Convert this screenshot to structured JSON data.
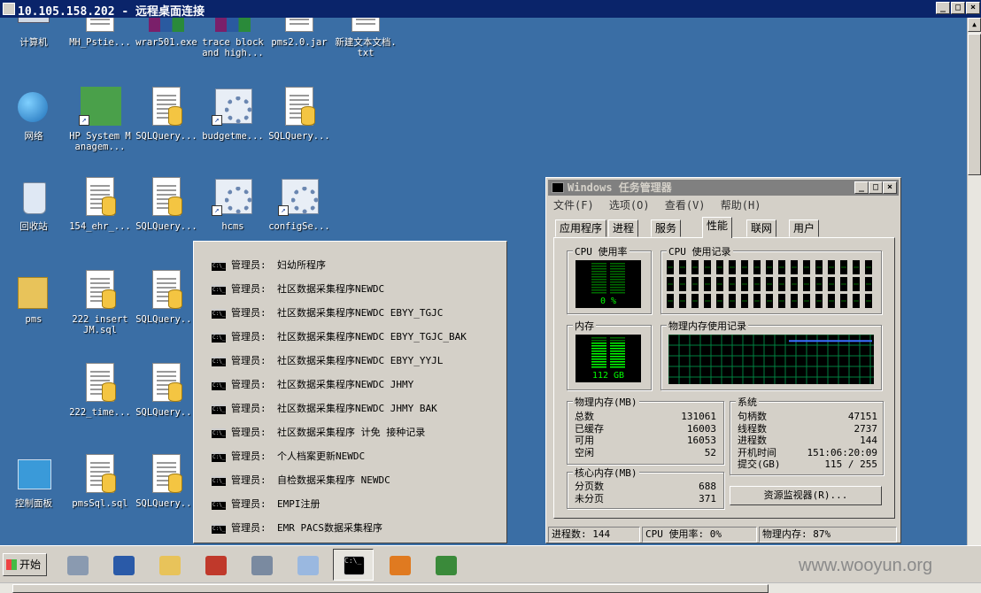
{
  "titlebar": {
    "title": "10.105.158.202 - 远程桌面连接",
    "controls": [
      "_",
      "□",
      "×"
    ]
  },
  "desktop_icons": [
    {
      "label": "计算机",
      "icon": "computer-icon"
    },
    {
      "label": "MH_Pstie...",
      "icon": "document-icon"
    },
    {
      "label": "wrar501.exe",
      "icon": "winrar-icon"
    },
    {
      "label": "trace block and high...",
      "icon": "winrar-archive-icon"
    },
    {
      "label": "pms2.0.jar",
      "icon": "java-jar-icon"
    },
    {
      "label": "新建文本文档.txt",
      "icon": "text-file-icon"
    },
    {
      "label": "网络",
      "icon": "network-icon"
    },
    {
      "label": "HP System Managem...",
      "icon": "hp-system-management-icon"
    },
    {
      "label": "SQLQuery...",
      "icon": "sql-file-icon"
    },
    {
      "label": "budgetme...",
      "icon": "config-shortcut-icon"
    },
    {
      "label": "SQLQuery...",
      "icon": "sql-file-icon"
    },
    {
      "label": "回收站",
      "icon": "recycle-bin-icon"
    },
    {
      "label": "154_ehr_...",
      "icon": "sql-file-icon"
    },
    {
      "label": "SQLQuery...",
      "icon": "sql-file-icon"
    },
    {
      "label": "hcms",
      "icon": "config-shortcut-icon"
    },
    {
      "label": "configSe...",
      "icon": "config-shortcut-icon"
    },
    {
      "label": "pms",
      "icon": "folder-icon"
    },
    {
      "label": "222 insert JM.sql",
      "icon": "sql-file-icon"
    },
    {
      "label": "SQLQuery...",
      "icon": "sql-file-icon"
    },
    {
      "label": "222_time...",
      "icon": "sql-file-icon"
    },
    {
      "label": "SQLQuery...",
      "icon": "sql-file-icon"
    },
    {
      "label": "控制面板",
      "icon": "control-panel-icon"
    },
    {
      "label": "pmsSql.sql",
      "icon": "sql-file-icon"
    },
    {
      "label": "SQLQuery...",
      "icon": "sql-file-icon"
    }
  ],
  "context_menu": {
    "admin_prefix": "管理员:",
    "items": [
      "妇幼所程序",
      "社区数据采集程序NEWDC",
      "社区数据采集程序NEWDC EBYY_TGJC",
      "社区数据采集程序NEWDC EBYY_TGJC_BAK",
      "社区数据采集程序NEWDC EBYY_YYJL",
      "社区数据采集程序NEWDC JHMY",
      "社区数据采集程序NEWDC JHMY BAK",
      "社区数据采集程序 计免 接种记录",
      "个人档案更新NEWDC",
      "自检数据采集程序 NEWDC",
      "EMPI注册",
      "EMR PACS数据采集程序"
    ]
  },
  "task_manager": {
    "title": "Windows 任务管理器",
    "menu": [
      "文件(F)",
      "选项(O)",
      "查看(V)",
      "帮助(H)"
    ],
    "tabs": [
      "应用程序",
      "进程",
      "服务",
      "性能",
      "联网",
      "用户"
    ],
    "active_tab": "性能",
    "cpu_usage_label": "CPU 使用率",
    "cpu_usage_value": "0 %",
    "cpu_history_label": "CPU 使用记录",
    "memory_label": "内存",
    "memory_value": "112 GB",
    "memory_history_label": "物理内存使用记录",
    "memory_used_fraction": 0.87,
    "physical_memory": {
      "label": "物理内存(MB)",
      "rows": [
        {
          "k": "总数",
          "v": "131061"
        },
        {
          "k": "已缓存",
          "v": "16003"
        },
        {
          "k": "可用",
          "v": "16053"
        },
        {
          "k": "空闲",
          "v": "52"
        }
      ]
    },
    "system": {
      "label": "系统",
      "rows": [
        {
          "k": "句柄数",
          "v": "47151"
        },
        {
          "k": "线程数",
          "v": "2737"
        },
        {
          "k": "进程数",
          "v": "144"
        },
        {
          "k": "开机时间",
          "v": "151:06:20:09"
        },
        {
          "k": "提交(GB)",
          "v": "115 / 255"
        }
      ]
    },
    "kernel_memory": {
      "label": "核心内存(MB)",
      "rows": [
        {
          "k": "分页数",
          "v": "688"
        },
        {
          "k": "未分页",
          "v": "371"
        }
      ]
    },
    "resource_monitor_button": "资源监视器(R)...",
    "status": {
      "processes": "进程数: 144",
      "cpu": "CPU 使用率: 0%",
      "memory": "物理内存: 87%"
    },
    "screen_color": "#00ff00"
  },
  "taskbar": {
    "start_label": "开始",
    "items": [
      "server-manager-icon",
      "powershell-icon",
      "explorer-icon",
      "flash-icon",
      "tools-icon",
      "notepad-icon",
      "cmd-icon",
      "java-icon",
      "task-manager-icon"
    ]
  },
  "watermark": "www.wooyun.org"
}
